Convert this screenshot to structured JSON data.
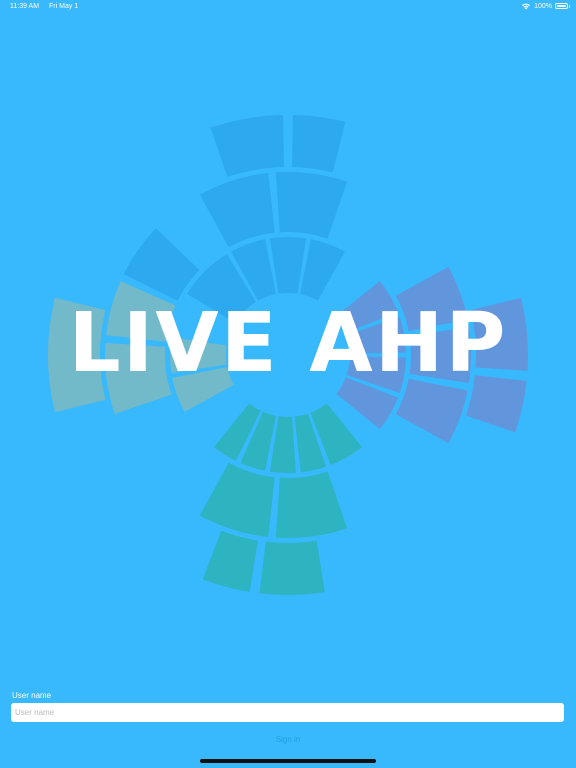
{
  "status_bar": {
    "time": "11:39 AM",
    "date": "Fri May 1",
    "battery": "100%",
    "icons": [
      "wifi-icon",
      "battery-icon"
    ]
  },
  "logo": {
    "title": "LIVE AHP",
    "segment_colors": {
      "blue": "#2aa6ec",
      "purple": "#6a8fd6",
      "teal": "#2bb3b5",
      "sage": "#7cb9c0"
    }
  },
  "login": {
    "username_label": "User name",
    "username_placeholder": "User name",
    "username_value": "",
    "signin_label": "Sign in"
  },
  "colors": {
    "background": "#38b8fd",
    "signin_text": "#1ea0e6"
  }
}
